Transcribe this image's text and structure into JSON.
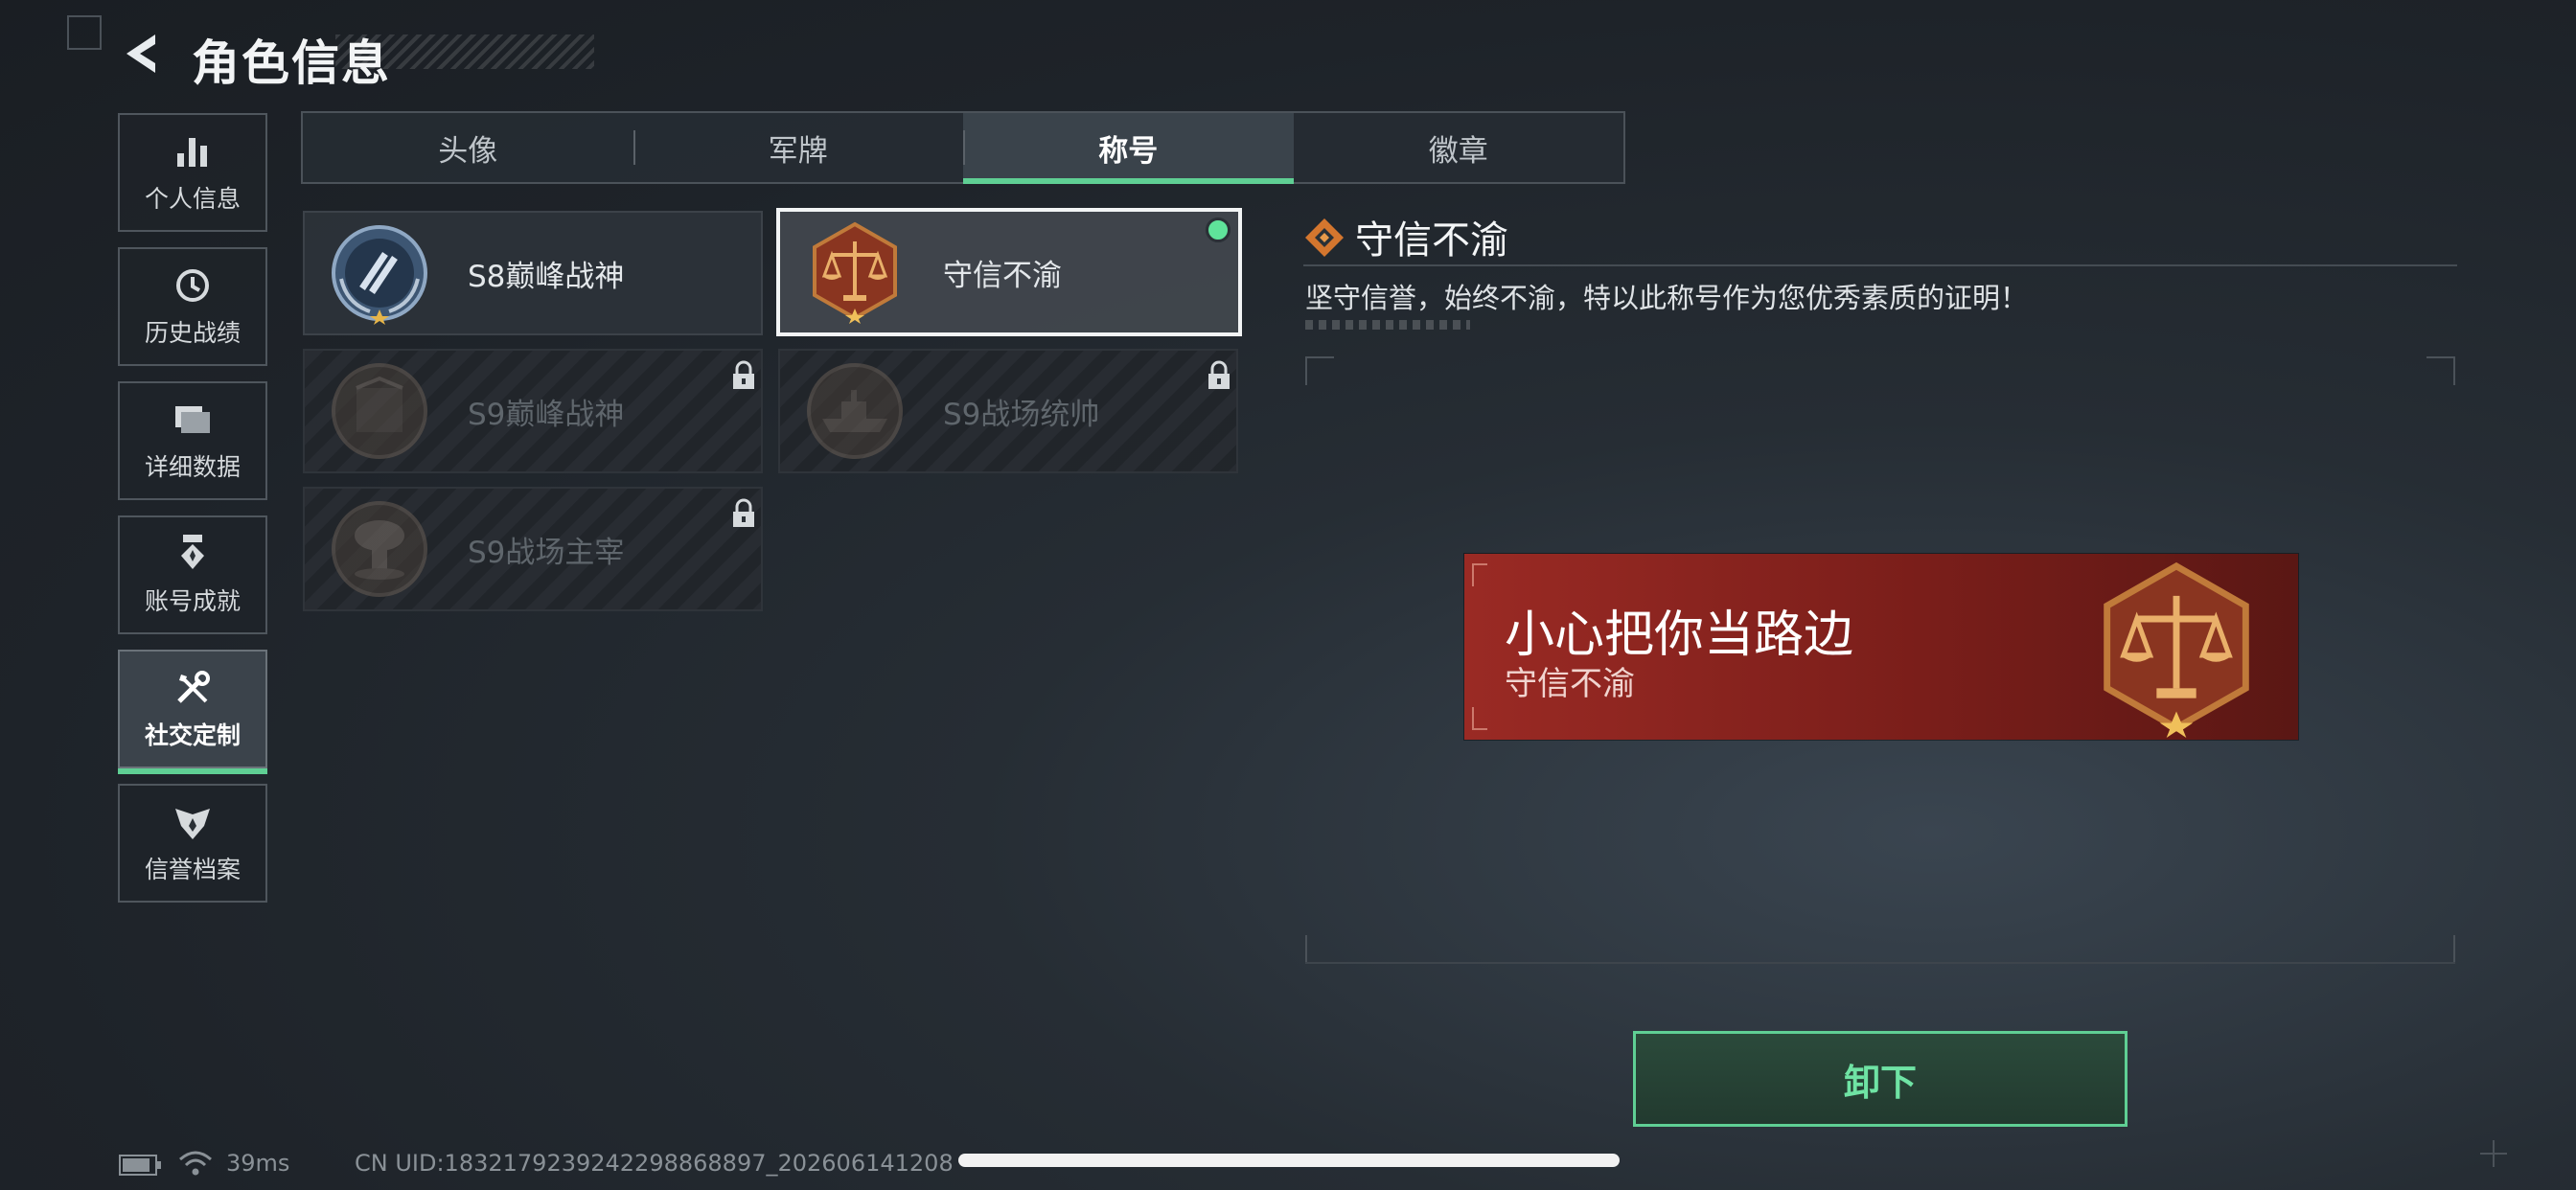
{
  "header": {
    "title": "角色信息"
  },
  "sidebar": {
    "items": [
      {
        "label": "个人信息",
        "icon": "bar-chart-icon"
      },
      {
        "label": "历史战绩",
        "icon": "history-clock-icon"
      },
      {
        "label": "详细数据",
        "icon": "folder-icon"
      },
      {
        "label": "账号成就",
        "icon": "achievement-medal-icon"
      },
      {
        "label": "社交定制",
        "icon": "wrench-screwdriver-icon",
        "active": true
      },
      {
        "label": "信誉档案",
        "icon": "shield-wings-icon"
      }
    ]
  },
  "tabs": [
    {
      "label": "头像"
    },
    {
      "label": "军牌"
    },
    {
      "label": "称号",
      "active": true
    },
    {
      "label": "徽章"
    }
  ],
  "titles": [
    {
      "name": "S8巅峰战神",
      "locked": false,
      "selected": false,
      "icon": "s8-laurel-emblem-icon"
    },
    {
      "name": "守信不渝",
      "locked": false,
      "selected": true,
      "equipped": true,
      "icon": "scales-emblem-icon"
    },
    {
      "name": "S9巅峰战神",
      "locked": true,
      "icon": "s9-emblem-icon"
    },
    {
      "name": "S9战场统帅",
      "locked": true,
      "icon": "warship-emblem-icon"
    },
    {
      "name": "S9战场主宰",
      "locked": true,
      "icon": "mushroom-cloud-emblem-icon"
    }
  ],
  "detail": {
    "title": "守信不渝",
    "description": "坚守信誉，始终不渝，特以此称号作为您优秀素质的证明！",
    "banner": {
      "player_name": "小心把你当路边",
      "title": "守信不渝"
    },
    "action_label": "卸下"
  },
  "status_bar": {
    "ping": "39ms",
    "uid": "CN UID:1832179239242298868897_202606141208"
  },
  "colors": {
    "accent_green": "#5fcf94",
    "banner_red": "#9a2a24",
    "emblem_bronze": "#c07a3a"
  }
}
